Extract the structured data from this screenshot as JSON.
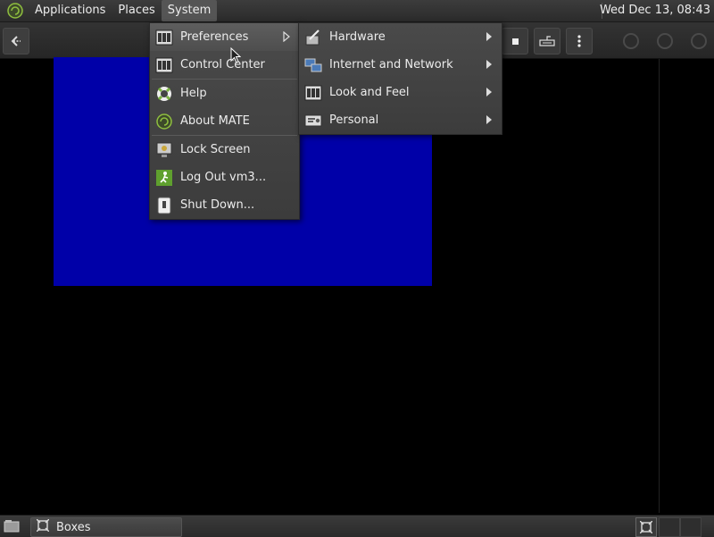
{
  "top_panel": {
    "menus": [
      "Applications",
      "Places",
      "System"
    ],
    "clock": "Wed Dec 13, 08:43"
  },
  "system_menu": {
    "items": [
      {
        "label": "Preferences",
        "icon": "preferences-icon",
        "has_submenu": true
      },
      {
        "label": "Control Center",
        "icon": "control-center-icon"
      },
      {
        "label": "Help",
        "icon": "help-lifebuoy-icon"
      },
      {
        "label": "About MATE",
        "icon": "mate-logo-icon"
      },
      {
        "label": "Lock Screen",
        "icon": "lock-screen-icon"
      },
      {
        "label": "Log Out vm3...",
        "icon": "log-out-icon"
      },
      {
        "label": "Shut Down...",
        "icon": "shut-down-icon"
      }
    ]
  },
  "preferences_submenu": {
    "items": [
      {
        "label": "Hardware",
        "icon": "hardware-icon"
      },
      {
        "label": "Internet and Network",
        "icon": "network-icon"
      },
      {
        "label": "Look and Feel",
        "icon": "look-and-feel-icon"
      },
      {
        "label": "Personal",
        "icon": "personal-icon"
      }
    ]
  },
  "taskbar": {
    "window_label": "Boxes"
  },
  "colors": {
    "vm_screen": "#0000a8",
    "panel": "#2b2b2b",
    "menu_bg": "#444444"
  }
}
